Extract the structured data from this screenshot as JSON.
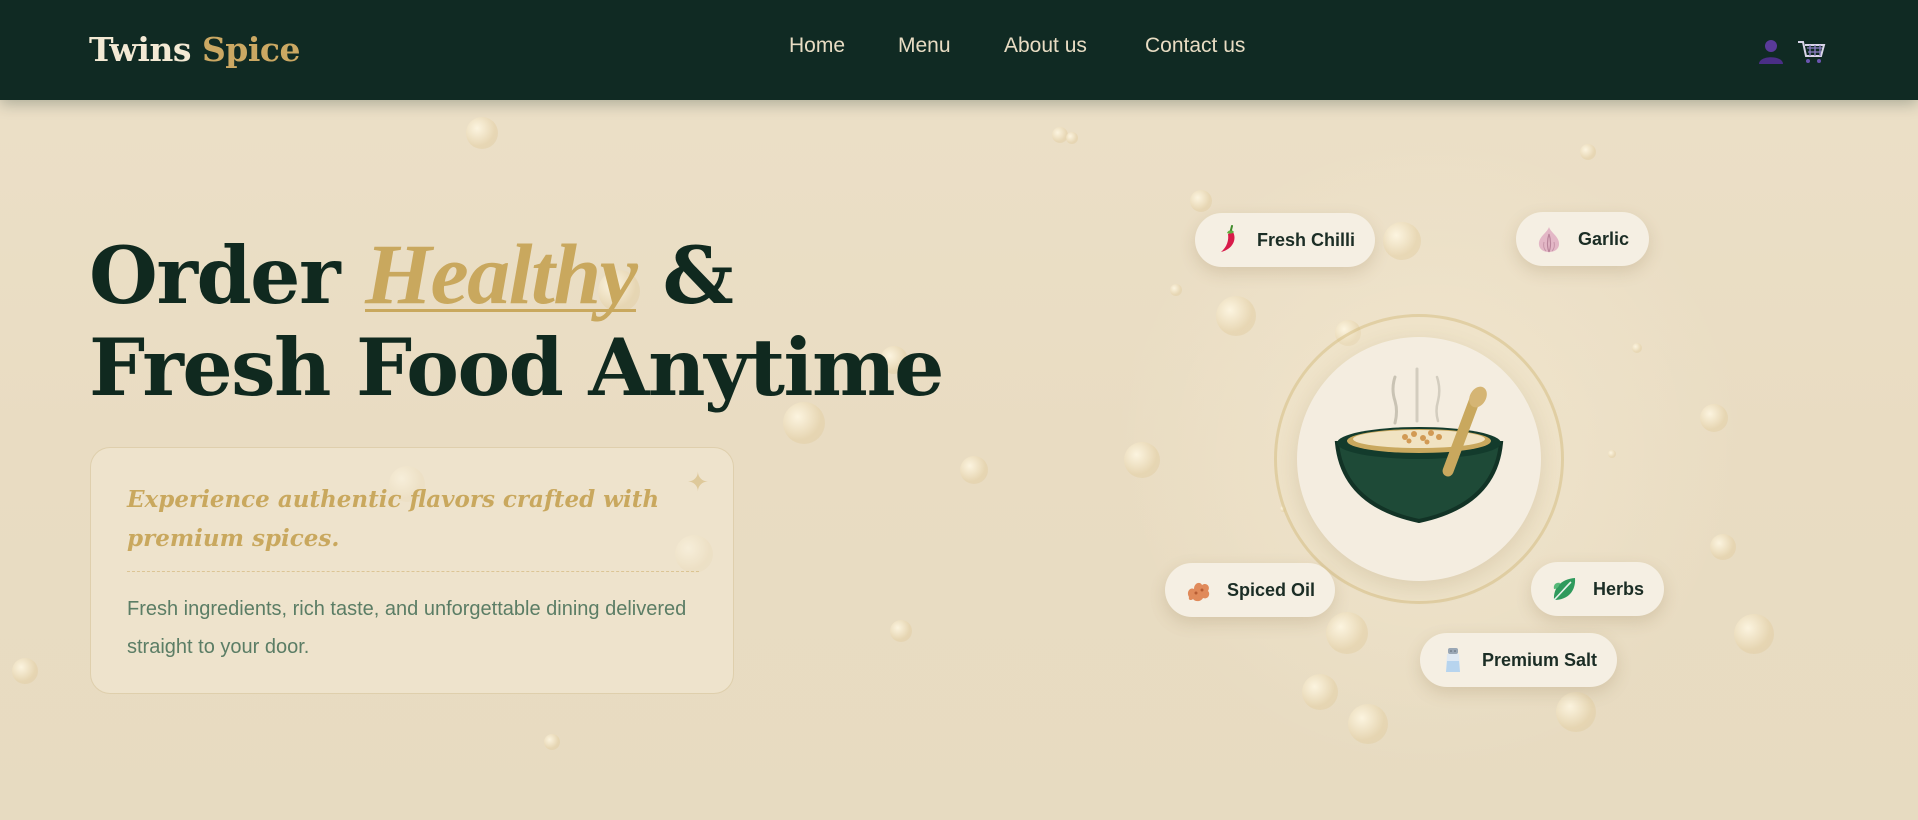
{
  "brand": {
    "first": "Twins",
    "second": "Spice"
  },
  "nav": {
    "links": [
      "Home",
      "Menu",
      "About us",
      "Contact us"
    ],
    "icons": [
      "user-icon",
      "cart-icon"
    ]
  },
  "hero": {
    "title_line1_prefix": "Order",
    "title_accent": "Healthy",
    "title_ampersand": "&",
    "title_line2": "Fresh Food Anytime",
    "tagline": "Experience authentic flavors crafted with premium spices.",
    "description": "Fresh ingredients, rich taste, and unforgettable dining delivered straight to your door."
  },
  "ingredients": [
    {
      "label": "Fresh Chilli",
      "icon": "chilli-icon"
    },
    {
      "label": "Garlic",
      "icon": "garlic-icon"
    },
    {
      "label": "Spiced Oil",
      "icon": "ginger-icon"
    },
    {
      "label": "Herbs",
      "icon": "herb-leaf-icon"
    },
    {
      "label": "Premium Salt",
      "icon": "salt-shaker-icon"
    }
  ],
  "colors": {
    "navbar_bg": "#102a23",
    "accent_gold": "#c9a85e",
    "heading_green": "#10291f",
    "page_bg": "#ece0c8",
    "body_text": "#5b7d65",
    "bowl_green": "#1e4a37"
  }
}
